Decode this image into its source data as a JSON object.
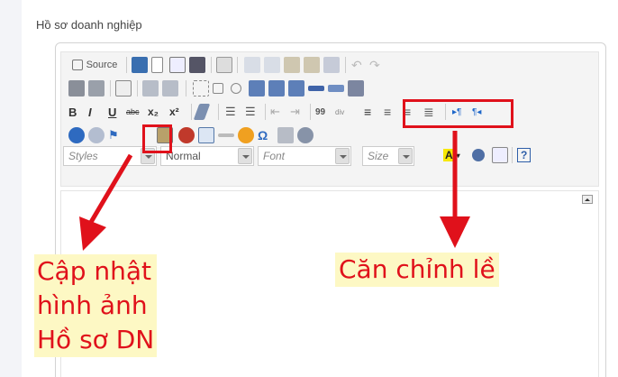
{
  "page": {
    "title": "Hồ sơ doanh nghiệp"
  },
  "toolbar": {
    "source_label": "Source",
    "styles_label": "Styles",
    "format_label": "Normal",
    "font_label": "Font",
    "size_label": "Size",
    "text_color_label": "A",
    "bold_label": "B",
    "italic_label": "I",
    "underline_label": "U",
    "strike_label": "abc",
    "sub_label": "x₂",
    "sup_label": "x²",
    "quote_label": "99",
    "div_label": "div",
    "help_label": "?"
  },
  "annotations": {
    "left_lines": [
      "Cập nhật",
      "hình ảnh",
      "Hồ sơ DN"
    ],
    "right_label": "Căn chỉnh lề"
  },
  "colors": {
    "highlight": "#e0111b",
    "label_bg": "#fdf8c4"
  }
}
